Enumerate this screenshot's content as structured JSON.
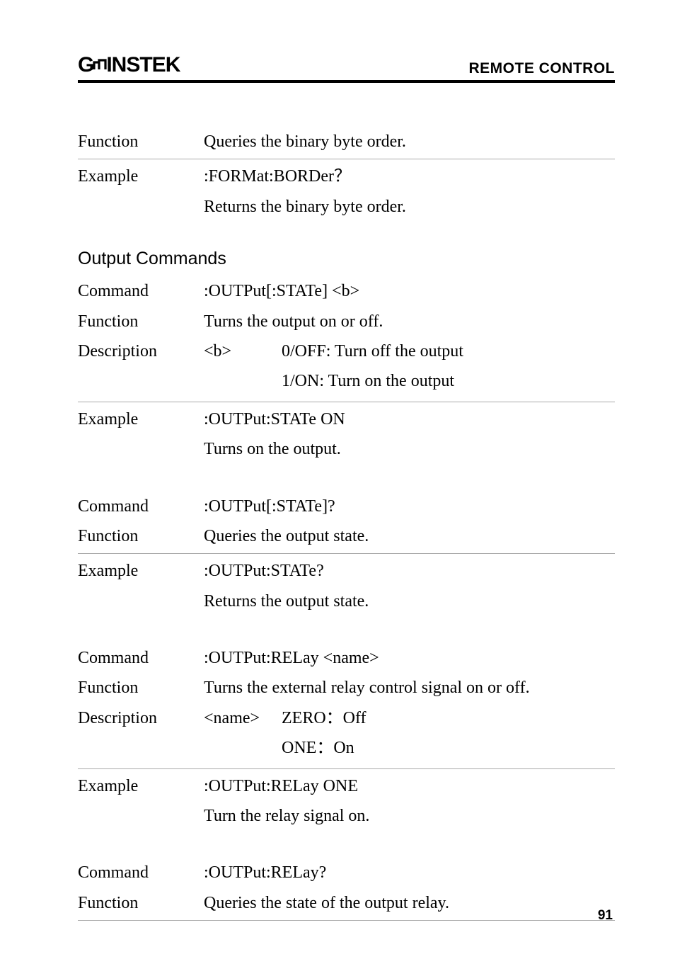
{
  "header": {
    "logo_text_pre": "G",
    "logo_text_post": "INSTEK",
    "doc_title": "REMOTE CONTROL"
  },
  "s1": {
    "r1_label": "Function",
    "r1_value": "Queries the binary byte order.",
    "r2_label": "Example",
    "r2_line1": ":FORMat:BORDer？",
    "r2_line2": "Returns the binary byte order."
  },
  "sec_title": "Output Commands",
  "s2": {
    "r1_label": "Command",
    "r1_value": ":OUTPut[:STATe] <b>",
    "r2_label": "Function",
    "r2_value": "Turns the output on or off.",
    "r3_label": "Description",
    "r3_param": "<b>",
    "r3_d1": "0/OFF: Turn off the output",
    "r3_d2": "1/ON: Turn on the output",
    "r4_label": "Example",
    "r4_line1": ":OUTPut:STATe ON",
    "r4_line2": "Turns on the output."
  },
  "s3": {
    "r1_label": "Command",
    "r1_value": ":OUTPut[:STATe]?",
    "r2_label": "Function",
    "r2_value": "Queries the output state.",
    "r3_label": "Example",
    "r3_line1": ":OUTPut:STATe?",
    "r3_line2": "Returns the output state."
  },
  "s4": {
    "r1_label": "Command",
    "r1_value": ":OUTPut:RELay <name>",
    "r2_label": "Function",
    "r2_value": "Turns the external relay control signal on or off.",
    "r3_label": "Description",
    "r3_param": "<name>",
    "r3_d1": "ZERO：Off",
    "r3_d2": "ONE：On",
    "r4_label": "Example",
    "r4_line1": ":OUTPut:RELay ONE",
    "r4_line2": "Turn the relay signal on."
  },
  "s5": {
    "r1_label": "Command",
    "r1_value": ":OUTPut:RELay?",
    "r2_label": "Function",
    "r2_value": "Queries the state of the output relay."
  },
  "page_num": "91"
}
